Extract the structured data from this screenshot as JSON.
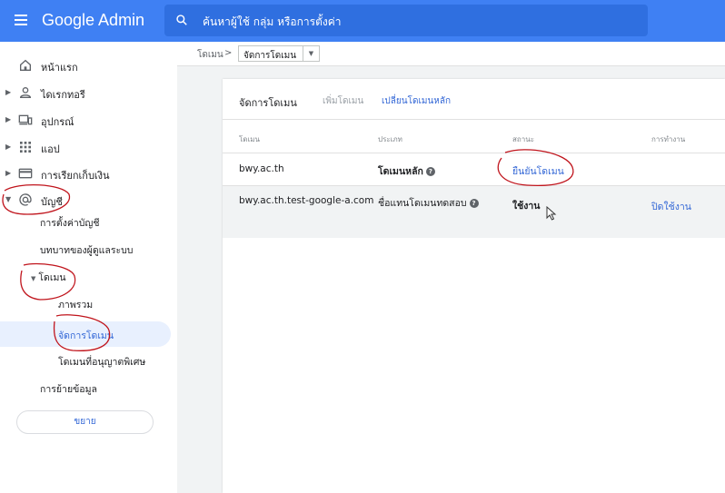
{
  "header": {
    "app_title": "Google Admin",
    "search_placeholder": "ค้นหาผู้ใช้ กลุ่ม หรือการตั้งค่า"
  },
  "breadcrumb": {
    "root": "โดเมน",
    "separator": ">",
    "current": "จัดการโดเมน"
  },
  "sidebar": {
    "items": [
      {
        "label": "หน้าแรก"
      },
      {
        "label": "ไดเรกทอรี"
      },
      {
        "label": "อุปกรณ์"
      },
      {
        "label": "แอป"
      },
      {
        "label": "การเรียกเก็บเงิน"
      },
      {
        "label": "บัญชี"
      }
    ],
    "account_children": [
      {
        "label": "การตั้งค่าบัญชี"
      },
      {
        "label": "บทบาทของผู้ดูแลระบบ"
      },
      {
        "label": "โดเมน"
      }
    ],
    "domain_children": [
      {
        "label": "ภาพรวม"
      },
      {
        "label": "จัดการโดเมน"
      },
      {
        "label": "โดเมนที่อนุญาตพิเศษ"
      }
    ],
    "migration": "การย้ายข้อมูล",
    "expand_label": "ขยาย"
  },
  "card": {
    "tabs": {
      "title": "จัดการโดเมน",
      "add": "เพิ่มโดเมน",
      "change_primary": "เปลี่ยนโดเมนหลัก"
    },
    "columns": {
      "domain": "โดเมน",
      "type": "ประเภท",
      "status": "สถานะ",
      "action": "การทำงาน"
    },
    "rows": [
      {
        "domain": "bwy.ac.th",
        "type": "โดเมนหลัก",
        "status": "ยืนยันโดเมน",
        "action": ""
      },
      {
        "domain": "bwy.ac.th.test-google-a.com",
        "type": "ชื่อแทนโดเมนทดสอบ",
        "status": "ใช้งาน",
        "action": "ปิดใช้งาน"
      }
    ]
  },
  "colors": {
    "topbar": "#3f80f3",
    "link": "#3367d6",
    "annotation": "#c0141c"
  }
}
